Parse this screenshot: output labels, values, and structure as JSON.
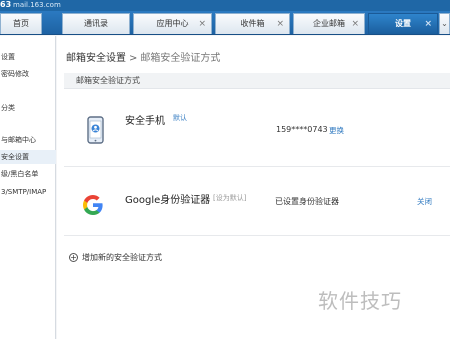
{
  "header": {
    "logo": "63",
    "site": "mail.163.com"
  },
  "tabs": [
    {
      "label": "首页"
    },
    {
      "label": "通讯录"
    },
    {
      "label": "应用中心"
    },
    {
      "label": "收件箱"
    },
    {
      "label": "企业邮箱"
    },
    {
      "label": "设置"
    }
  ],
  "icons": {
    "close": "×",
    "dropdown": "⌄"
  },
  "sidebar": {
    "items": [
      {
        "label": "设置"
      },
      {
        "label": "密码修改"
      },
      {
        "label": "分类"
      },
      {
        "label": "与邮箱中心"
      },
      {
        "label": "安全设置"
      },
      {
        "label": "级/黑白名单"
      },
      {
        "label": "3/SMTP/IMAP"
      }
    ]
  },
  "breadcrumb": {
    "parent": "邮箱安全设置",
    "separator": ">",
    "current": "邮箱安全验证方式"
  },
  "section_title": "邮箱安全验证方式",
  "methods": [
    {
      "name": "安全手机",
      "tag": "默认",
      "value": "159****0743",
      "action": "更换",
      "icon": "phone-icon"
    },
    {
      "name": "Google身份验证器",
      "tag": "[设为默认]",
      "value": "已设置身份验证器",
      "action": "关闭",
      "icon": "google-g-icon"
    }
  ],
  "add_method": {
    "icon": "+",
    "label": "增加新的安全验证方式"
  },
  "watermark": "软件技巧",
  "colors": {
    "accent": "#1f67a6",
    "link": "#2f79c0"
  }
}
